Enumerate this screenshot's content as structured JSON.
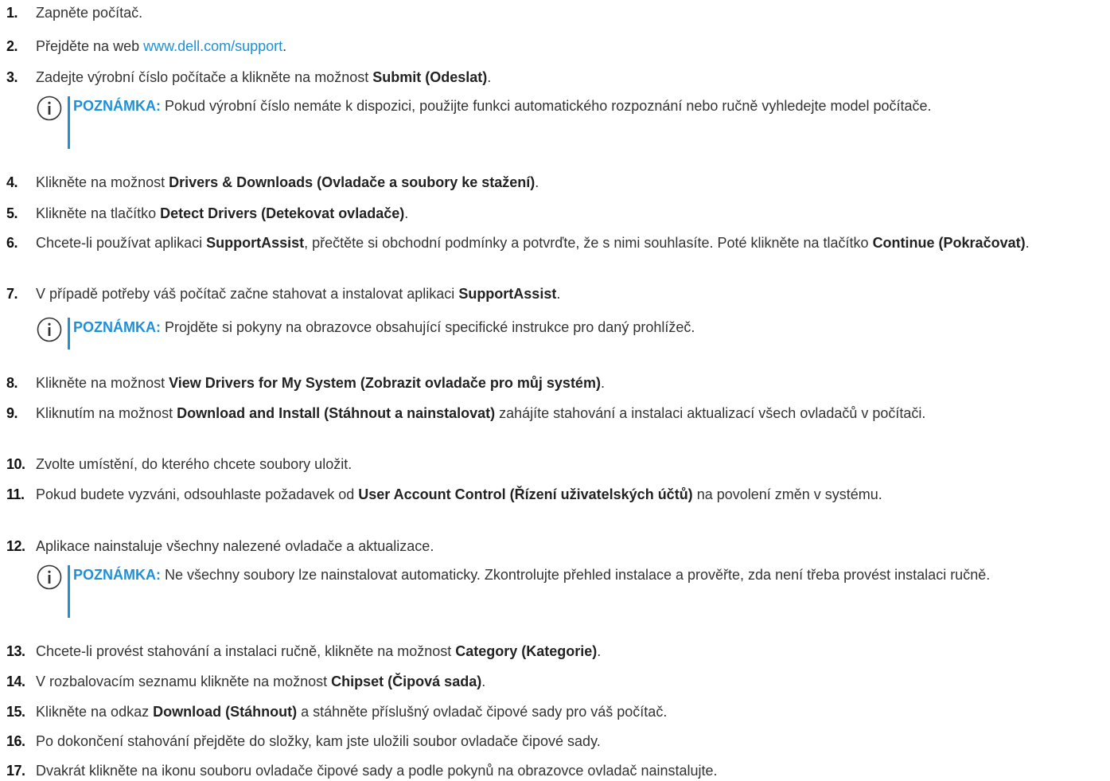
{
  "steps": [
    {
      "n": "1.",
      "parts": [
        {
          "t": "Zapněte počítač."
        }
      ]
    },
    {
      "n": "2.",
      "parts": [
        {
          "t": "Přejděte na web "
        },
        {
          "t": "www.dell.com/support",
          "link": true
        },
        {
          "t": "."
        }
      ]
    },
    {
      "n": "3.",
      "parts": [
        {
          "t": "Zadejte výrobní číslo počítače a klikněte na možnost "
        },
        {
          "t": "Submit (Odeslat)",
          "b": true
        },
        {
          "t": "."
        }
      ]
    },
    {
      "n": "4.",
      "parts": [
        {
          "t": "Klikněte na možnost "
        },
        {
          "t": "Drivers & Downloads (Ovladače a soubory ke stažení)",
          "b": true
        },
        {
          "t": "."
        }
      ]
    },
    {
      "n": "5.",
      "parts": [
        {
          "t": "Klikněte na tlačítko "
        },
        {
          "t": "Detect Drivers (Detekovat ovladače)",
          "b": true
        },
        {
          "t": "."
        }
      ]
    },
    {
      "n": "6.",
      "parts": [
        {
          "t": "Chcete-li používat aplikaci "
        },
        {
          "t": "SupportAssist",
          "b": true
        },
        {
          "t": ", přečtěte si obchodní podmínky a potvrďte, že s nimi souhlasíte. Poté klikněte na tlačítko "
        },
        {
          "t": "Continue (Pokračovat)",
          "b": true
        },
        {
          "t": "."
        }
      ]
    },
    {
      "n": "7.",
      "parts": [
        {
          "t": "V případě potřeby váš počítač začne stahovat a instalovat aplikaci "
        },
        {
          "t": "SupportAssist",
          "b": true
        },
        {
          "t": "."
        }
      ]
    },
    {
      "n": "8.",
      "parts": [
        {
          "t": "Klikněte na možnost "
        },
        {
          "t": "View Drivers for My System (Zobrazit ovladače pro můj systém)",
          "b": true
        },
        {
          "t": "."
        }
      ]
    },
    {
      "n": "9.",
      "parts": [
        {
          "t": "Kliknutím na možnost "
        },
        {
          "t": "Download and Install (Stáhnout a nainstalovat)",
          "b": true
        },
        {
          "t": " zahájíte stahování a instalaci aktualizací všech ovladačů v počítači."
        }
      ]
    },
    {
      "n": "10.",
      "parts": [
        {
          "t": "Zvolte umístění, do kterého chcete soubory uložit."
        }
      ]
    },
    {
      "n": "11.",
      "parts": [
        {
          "t": "Pokud budete vyzváni, odsouhlaste požadavek od "
        },
        {
          "t": "User Account Control (Řízení uživatelských účtů)",
          "b": true
        },
        {
          "t": " na povolení změn v systému."
        }
      ]
    },
    {
      "n": "12.",
      "parts": [
        {
          "t": "Aplikace nainstaluje všechny nalezené ovladače a aktualizace."
        }
      ]
    },
    {
      "n": "13.",
      "parts": [
        {
          "t": "Chcete-li provést stahování a instalaci ručně, klikněte na možnost "
        },
        {
          "t": "Category (Kategorie)",
          "b": true
        },
        {
          "t": "."
        }
      ]
    },
    {
      "n": "14.",
      "parts": [
        {
          "t": "V rozbalovacím seznamu klikněte na možnost "
        },
        {
          "t": "Chipset (Čipová sada)",
          "b": true
        },
        {
          "t": "."
        }
      ]
    },
    {
      "n": "15.",
      "parts": [
        {
          "t": "Klikněte na odkaz "
        },
        {
          "t": "Download (Stáhnout)",
          "b": true
        },
        {
          "t": " a stáhněte příslušný ovladač čipové sady pro váš počítač."
        }
      ]
    },
    {
      "n": "16.",
      "parts": [
        {
          "t": "Po dokončení stahování přejděte do složky, kam jste uložili soubor ovladače čipové sady."
        }
      ]
    },
    {
      "n": "17.",
      "parts": [
        {
          "t": "Dvakrát klikněte na ikonu souboru ovladače čipové sady a podle pokynů na obrazovce ovladač nainstalujte."
        }
      ]
    }
  ],
  "notes": [
    {
      "label": "POZNÁMKA:",
      "text": " Pokud výrobní číslo nemáte k dispozici, použijte funkci automatického rozpoznání nebo ručně vyhledejte model počítače."
    },
    {
      "label": "POZNÁMKA:",
      "text": " Projděte si pokyny na obrazovce obsahující specifické instrukce pro daný prohlížeč."
    },
    {
      "label": "POZNÁMKA:",
      "text": " Ne všechny soubory lze nainstalovat automaticky. Zkontrolujte přehled instalace a prověřte, zda není třeba provést instalaci ručně."
    }
  ],
  "icon_name": "info-circle-icon",
  "accent_color": "#1f8fd6"
}
